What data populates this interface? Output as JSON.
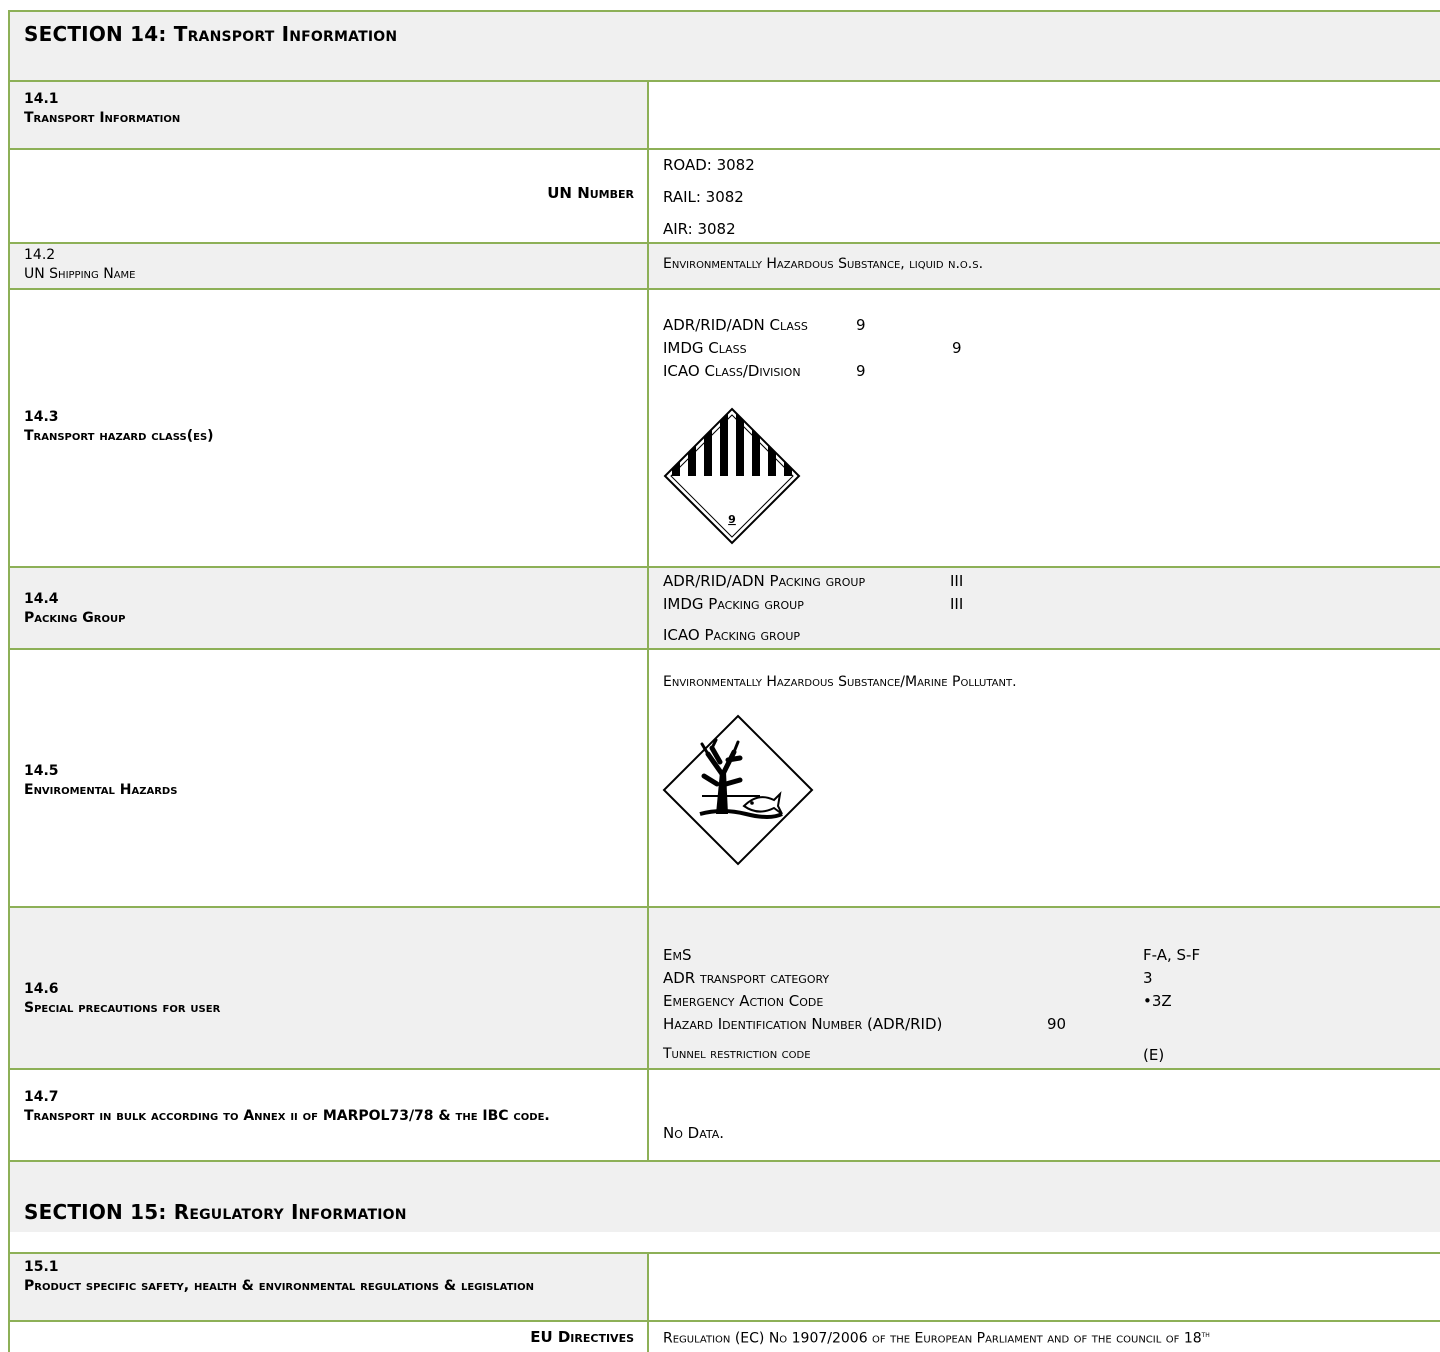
{
  "section14": {
    "title": "SECTION 14: Transport Information",
    "s141": {
      "num": "14.1",
      "label": "Transport Information"
    },
    "un_number": {
      "label": "UN Number",
      "road": "ROAD: 3082",
      "rail": "RAIL: 3082",
      "air": "AIR: 3082"
    },
    "s142": {
      "num": "14.2",
      "label": "UN Shipping Name",
      "value": "Environmentally Hazardous Substance, liquid n.o.s."
    },
    "s143": {
      "num": "14.3",
      "label": "Transport hazard class(es)",
      "rows": [
        {
          "name": "ADR/RID/ADN Class",
          "value": "9"
        },
        {
          "name": "IMDG Class",
          "value": "9"
        },
        {
          "name": "ICAO Class/Division",
          "value": "9"
        }
      ],
      "pictogram": {
        "icon": "class-9-miscellaneous-hazard-icon",
        "digit": "9"
      }
    },
    "s144": {
      "num": "14.4",
      "label": "Packing Group",
      "rows": [
        {
          "name": "ADR/RID/ADN Packing group",
          "value": "III"
        },
        {
          "name": "IMDG Packing group",
          "value": "III"
        },
        {
          "name": "ICAO Packing group",
          "value": ""
        }
      ]
    },
    "s145": {
      "num": "14.5",
      "label": "Enviromental Hazards",
      "value": "Environmentally Hazardous Substance/Marine Pollutant.",
      "pictogram": {
        "icon": "environment-hazard-dead-tree-fish-icon"
      }
    },
    "s146": {
      "num": "14.6",
      "label": "Special precautions for user",
      "rows": [
        {
          "name": "EmS",
          "value": "F-A, S-F"
        },
        {
          "name": "ADR transport category",
          "value": "3"
        },
        {
          "name": "Emergency Action Code",
          "value": "•3Z"
        },
        {
          "name": "Hazard Identification Number (ADR/RID)",
          "value": "90"
        },
        {
          "name": "Tunnel restriction code",
          "value": "(E)"
        }
      ]
    },
    "s147": {
      "num": "14.7",
      "label": "Transport in bulk according to Annex ii of MARPOL73/78 & the IBC code.",
      "value": "No Data."
    }
  },
  "section15": {
    "title": "SECTION 15: Regulatory Information",
    "s151": {
      "num": "15.1",
      "label": "Product specific safety, health & environmental regulations & legislation"
    },
    "eu": {
      "label": "EU Directives",
      "value": "Regulation (EC) No 1907/2006 of the European Parliament and of the council of 18",
      "sup": "th"
    }
  },
  "colors": {
    "border": "#8db057",
    "band": "#f0f0f0"
  }
}
